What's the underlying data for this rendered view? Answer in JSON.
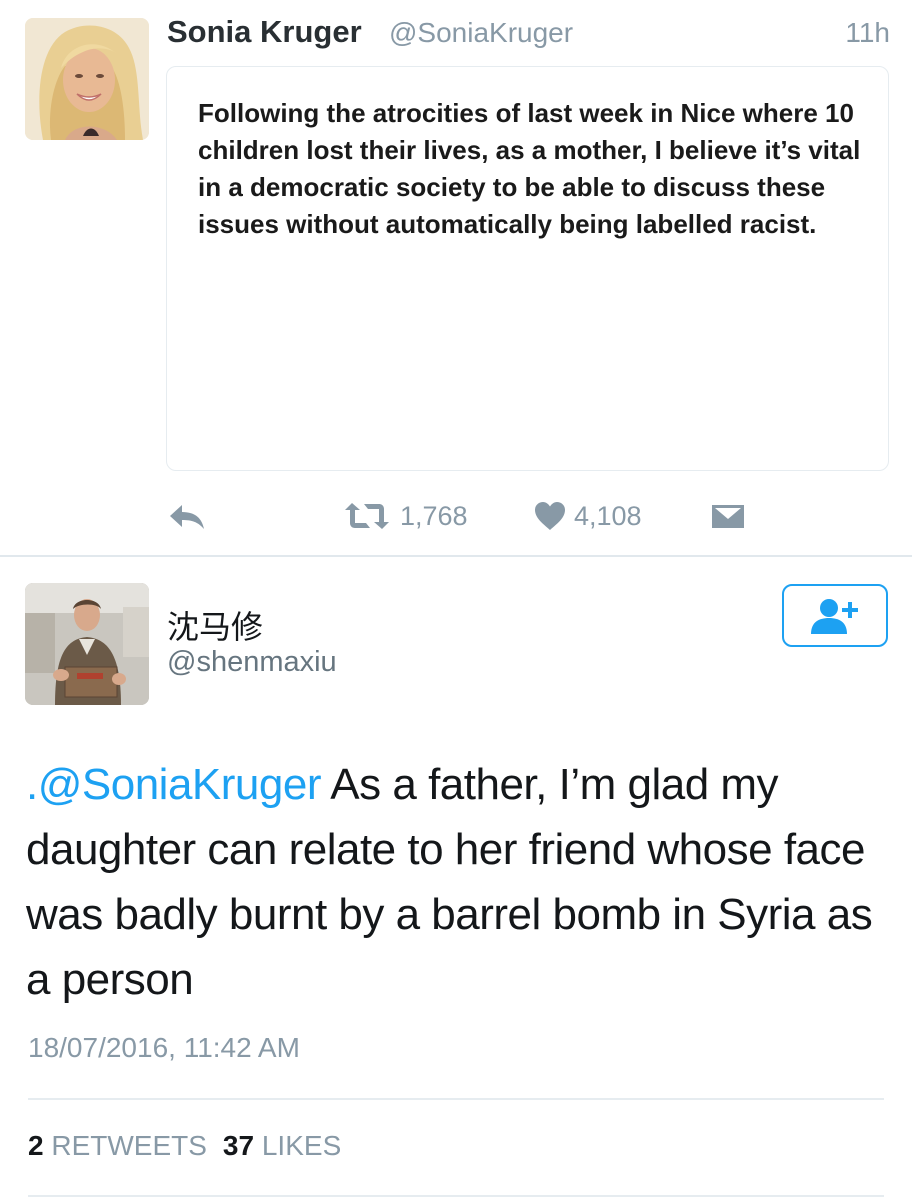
{
  "colors": {
    "accent": "#1da1f2",
    "muted": "#8899a6",
    "text": "#14171a",
    "border": "#e6ecf0"
  },
  "tweet1": {
    "avatar_icon": "profile-photo",
    "name": "Sonia Kruger",
    "handle": "@SoniaKruger",
    "time": "11h",
    "quote_text": "Following the atrocities of last week in Nice where 10 children lost their lives, as a mother, I believe it’s vital in a democratic society to be able to discuss these issues without automatically being labelled racist.",
    "actions": {
      "reply_icon": "reply-icon",
      "retweet_icon": "retweet-icon",
      "retweet_count": "1,768",
      "like_icon": "heart-icon",
      "like_count": "4,108",
      "dm_icon": "envelope-icon"
    }
  },
  "tweet2": {
    "avatar_icon": "profile-photo",
    "name": "沈马修",
    "handle": "@shenmaxiu",
    "follow_icon": "follow-user-icon",
    "mention": ".@SoniaKruger",
    "text": " As a father, I’m glad my daughter can relate to her friend whose face was badly burnt by a barrel bomb in Syria as a person",
    "date": "18/07/2016, 11:42 AM",
    "stats": {
      "retweets_count": "2",
      "retweets_label": "RETWEETS",
      "likes_count": "37",
      "likes_label": "LIKES"
    }
  }
}
